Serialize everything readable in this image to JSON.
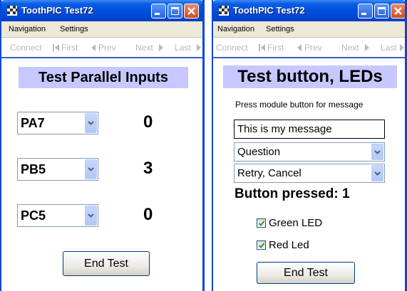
{
  "left_window": {
    "title": "ToothPIC Test72",
    "menu": {
      "navigation": "Navigation",
      "settings": "Settings"
    },
    "toolbar": {
      "connect": "Connect",
      "first": "First",
      "prev": "Prev",
      "next": "Next",
      "last": "Last"
    },
    "heading": "Test Parallel Inputs",
    "inputs": [
      {
        "port": "PA7",
        "value": "0"
      },
      {
        "port": "PB5",
        "value": "3"
      },
      {
        "port": "PC5",
        "value": "0"
      }
    ],
    "end_button": "End Test"
  },
  "right_window": {
    "title": "ToothPIC Test72",
    "menu": {
      "navigation": "Navigation",
      "settings": "Settings"
    },
    "toolbar": {
      "connect": "Connect",
      "first": "First",
      "prev": "Prev",
      "next": "Next",
      "last": "Last"
    },
    "heading": "Test button, LEDs",
    "instruction": "Press module button for message",
    "message_value": "This is my message",
    "icon_select": "Question",
    "buttons_select": "Retry, Cancel",
    "button_status": "Button pressed: 1",
    "green_led": {
      "label": "Green LED",
      "checked": true
    },
    "red_led": {
      "label": "Red Led",
      "checked": true
    },
    "end_button": "End Test"
  },
  "colors": {
    "titlebar": "#0050e0",
    "heading_bg": "#c6c8ff",
    "toolbar_disabled": "#b8b8b8",
    "close_button": "#d14d22"
  }
}
